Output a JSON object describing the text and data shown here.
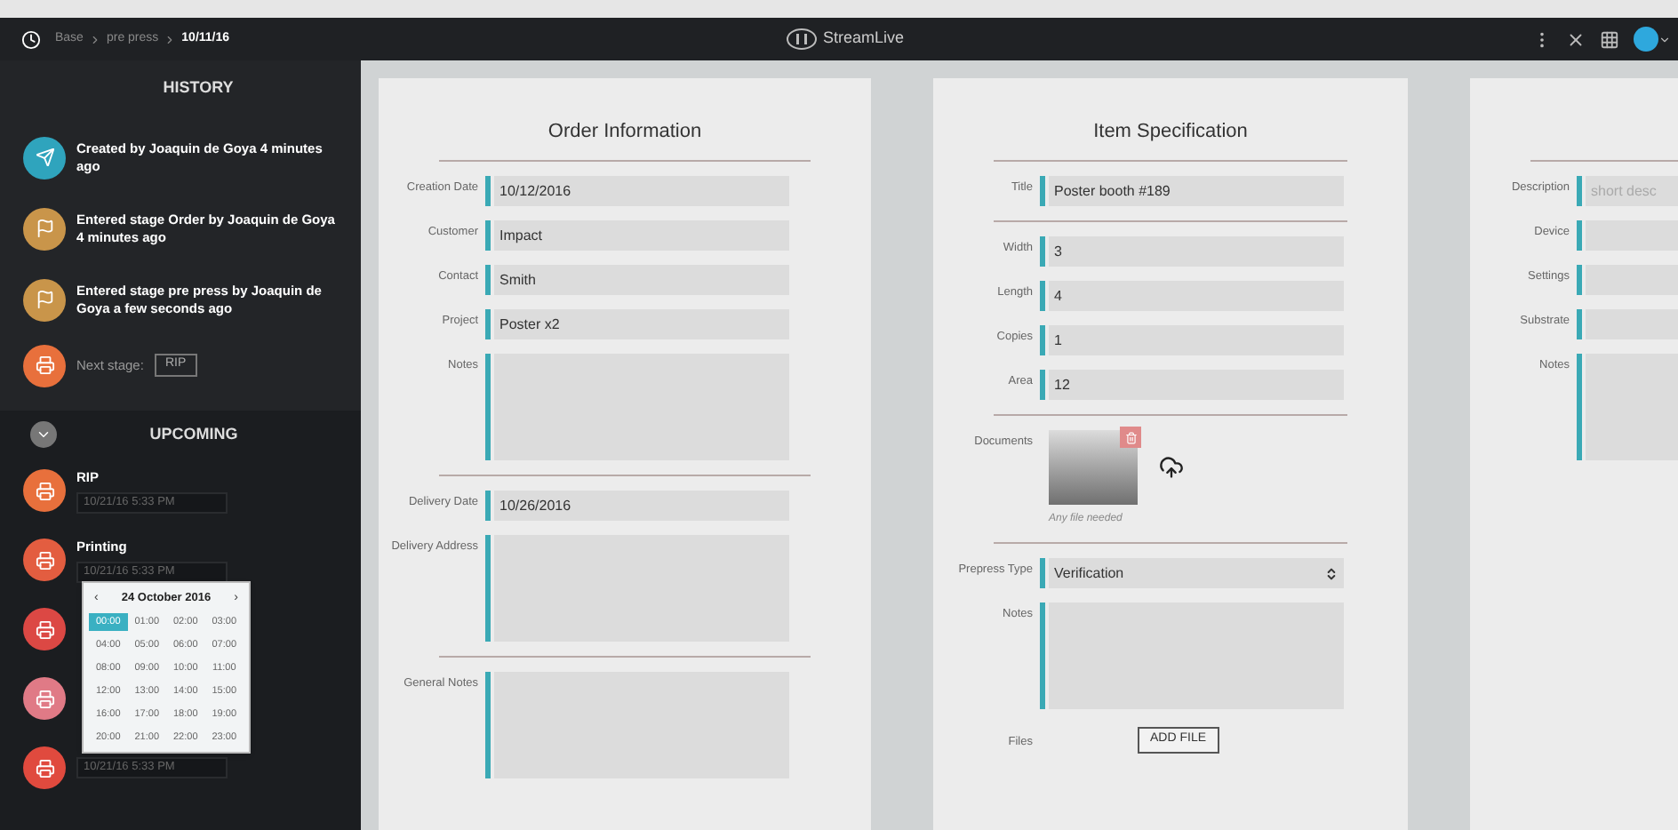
{
  "breadcrumb": [
    {
      "label": "Base",
      "current": false
    },
    {
      "label": "pre press",
      "current": false
    },
    {
      "label": "10/11/16",
      "current": true
    }
  ],
  "app_title": "StreamLive",
  "history": {
    "title": "HISTORY",
    "items": [
      {
        "kind": "created",
        "text": "Created by Joaquin de Goya 4 minutes ago"
      },
      {
        "kind": "stage",
        "text": "Entered stage Order by Joaquin de Goya 4 minutes ago"
      },
      {
        "kind": "stage",
        "text": "Entered stage pre press by Joaquin de Goya a few seconds ago"
      }
    ],
    "next_stage": {
      "label": "Next stage:",
      "button": "RIP"
    }
  },
  "upcoming": {
    "title": "UPCOMING",
    "expanded": true,
    "items": [
      {
        "name": "RIP",
        "date": "10/21/16 5:33 PM",
        "color": "#e8703c"
      },
      {
        "name": "Printing",
        "date": "10/21/16 5:33 PM",
        "color": "#e35d40"
      },
      {
        "color": "#dc4844"
      },
      {
        "color": "#e07a86"
      },
      {
        "date": "10/21/16 5:33 PM",
        "color": "#e04a3e"
      }
    ]
  },
  "date_picker": {
    "title": "24 October 2016",
    "prev": "‹",
    "next": "›",
    "hours": [
      {
        "label": "00:00",
        "selected": true
      },
      {
        "label": "01:00",
        "selected": false
      },
      {
        "label": "02:00",
        "selected": false
      },
      {
        "label": "03:00",
        "selected": false
      },
      {
        "label": "04:00",
        "selected": false
      },
      {
        "label": "05:00",
        "selected": false
      },
      {
        "label": "06:00",
        "selected": false
      },
      {
        "label": "07:00",
        "selected": false
      },
      {
        "label": "08:00",
        "selected": false
      },
      {
        "label": "09:00",
        "selected": false
      },
      {
        "label": "10:00",
        "selected": false
      },
      {
        "label": "11:00",
        "selected": false
      },
      {
        "label": "12:00",
        "selected": false
      },
      {
        "label": "13:00",
        "selected": false
      },
      {
        "label": "14:00",
        "selected": false
      },
      {
        "label": "15:00",
        "selected": false
      },
      {
        "label": "16:00",
        "selected": false
      },
      {
        "label": "17:00",
        "selected": false
      },
      {
        "label": "18:00",
        "selected": false
      },
      {
        "label": "19:00",
        "selected": false
      },
      {
        "label": "20:00",
        "selected": false
      },
      {
        "label": "21:00",
        "selected": false
      },
      {
        "label": "22:00",
        "selected": false
      },
      {
        "label": "23:00",
        "selected": false
      }
    ]
  },
  "cards": [
    {
      "title": "Order Information",
      "sections": [
        [
          {
            "kind": "input",
            "label": "Creation Date",
            "value": "10/12/2016"
          },
          {
            "kind": "input",
            "label": "Customer",
            "value": "Impact"
          },
          {
            "kind": "input",
            "label": "Contact",
            "value": "Smith"
          },
          {
            "kind": "input",
            "label": "Project",
            "value": "Poster x2"
          },
          {
            "kind": "textarea",
            "label": "Notes"
          }
        ],
        [
          {
            "kind": "input",
            "label": "Delivery Date",
            "value": "10/26/2016"
          },
          {
            "kind": "textarea",
            "label": "Delivery Address"
          }
        ],
        [
          {
            "kind": "textarea",
            "label": "General Notes"
          }
        ]
      ]
    },
    {
      "title": "Item Specification",
      "sections": [
        [
          {
            "kind": "input",
            "label": "Title",
            "value": "Poster booth #189"
          }
        ],
        [
          {
            "kind": "input",
            "label": "Width",
            "value": "3"
          },
          {
            "kind": "input",
            "label": "Length",
            "value": "4"
          },
          {
            "kind": "input",
            "label": "Copies",
            "value": "1"
          },
          {
            "kind": "input",
            "label": "Area",
            "value": "12"
          }
        ],
        [
          {
            "kind": "documents",
            "label": "Documents",
            "caption": "Any file needed"
          }
        ],
        [
          {
            "kind": "select",
            "label": "Prepress Type",
            "value": "Verification"
          },
          {
            "kind": "textarea",
            "label": "Notes"
          },
          {
            "kind": "files",
            "label": "Files",
            "button": "ADD FILE"
          }
        ]
      ]
    },
    {
      "sections": [
        [
          {
            "kind": "input",
            "label": "Description",
            "placeholder": "short desc"
          },
          {
            "kind": "input",
            "label": "Device"
          },
          {
            "kind": "input",
            "label": "Settings"
          },
          {
            "kind": "input",
            "label": "Substrate"
          },
          {
            "kind": "textarea",
            "label": "Notes"
          }
        ]
      ]
    }
  ]
}
